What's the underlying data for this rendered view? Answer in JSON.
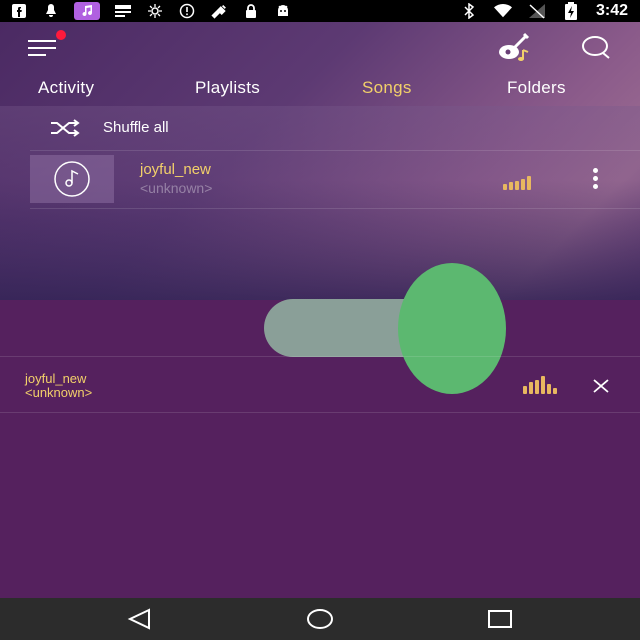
{
  "status_bar": {
    "time": "3:42",
    "left_icons": [
      "facebook-icon",
      "notification-icon",
      "music-icon",
      "cast-icon",
      "brightness-icon",
      "alert-icon",
      "satellite-icon",
      "lock-icon",
      "android-icon"
    ],
    "right_icons": [
      "bluetooth-icon",
      "wifi-icon",
      "signal-icon",
      "battery-icon"
    ]
  },
  "toolbar": {
    "menu_icon": "menu-icon",
    "guitar_icon": "guitar-icon",
    "search_icon": "search-icon",
    "notification_dot_color": "#ff1a3c"
  },
  "tabs": [
    {
      "label": "Activity",
      "active": false
    },
    {
      "label": "Playlists",
      "active": false
    },
    {
      "label": "Songs",
      "active": true
    },
    {
      "label": "Folders",
      "active": false
    }
  ],
  "shuffle": {
    "label": "Shuffle all",
    "icon": "shuffle-icon"
  },
  "songs": [
    {
      "title": "joyful_new",
      "artist": "<unknown>",
      "art_icon": "music-note-icon",
      "playing": true
    }
  ],
  "mini_player": {
    "title": "joyful_new",
    "artist": "<unknown>",
    "close_icon": "close-icon"
  },
  "colors": {
    "accent": "#f2d06a",
    "background": "#55215e",
    "fab_oval": "#5cb870",
    "fab_track": "#8a9f98"
  },
  "nav_bar": {
    "back_icon": "back-icon",
    "home_icon": "home-icon",
    "recents_icon": "recents-icon"
  }
}
